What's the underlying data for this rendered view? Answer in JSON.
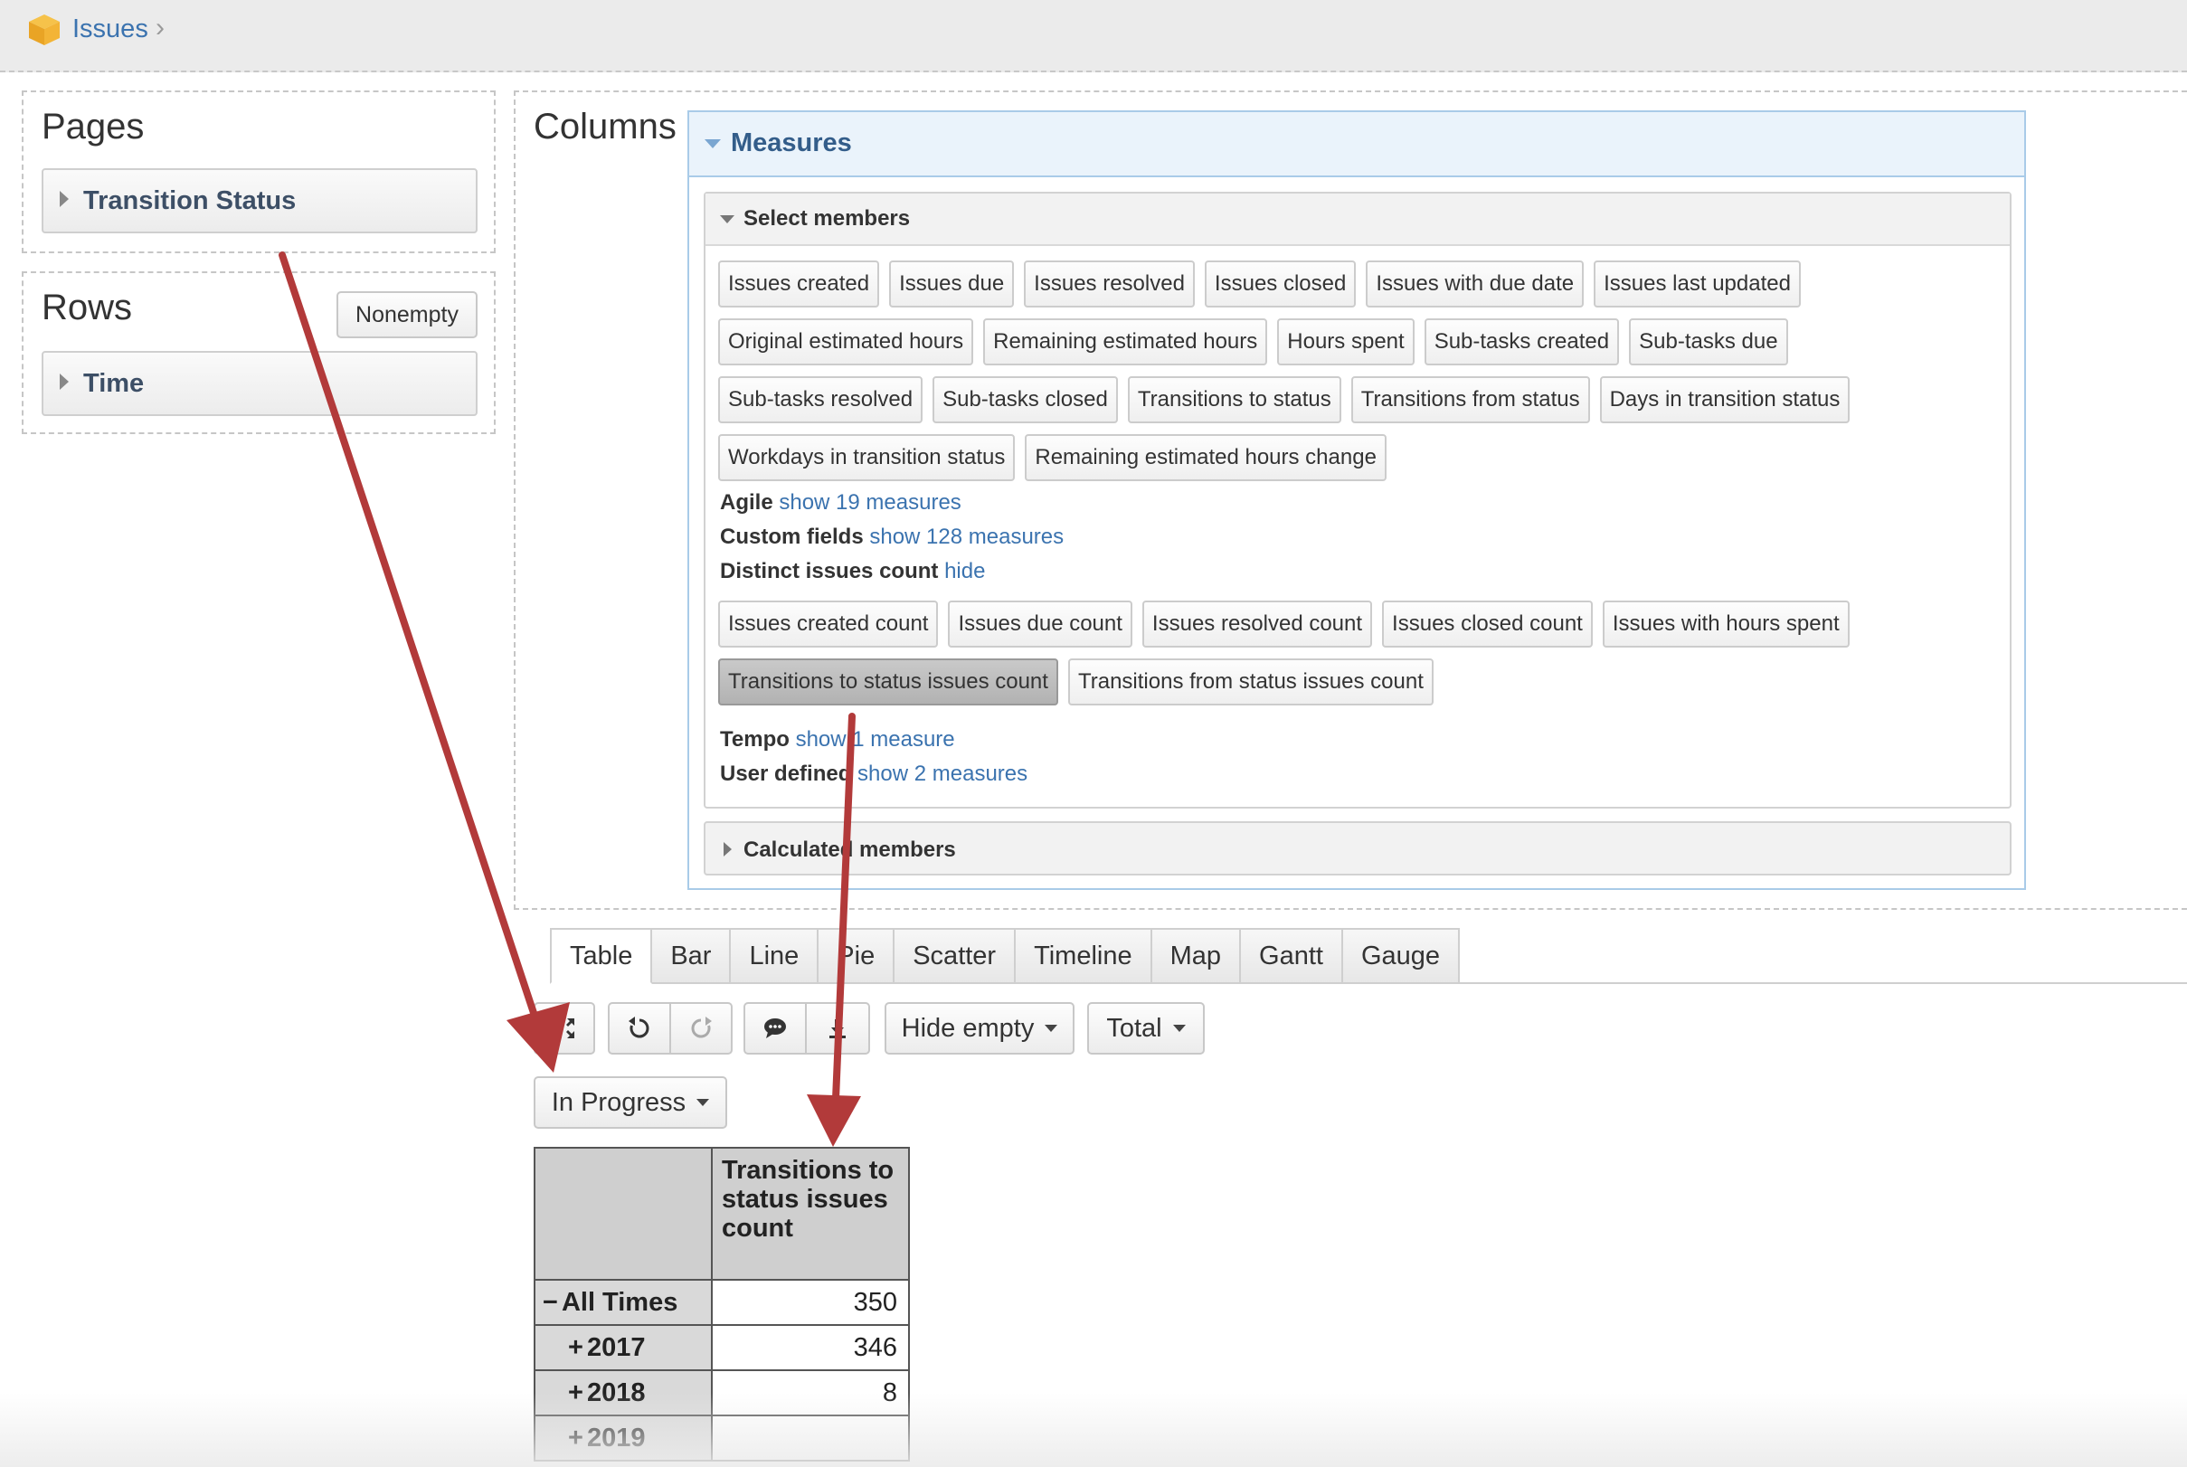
{
  "breadcrumb": {
    "root": "Issues"
  },
  "pages_panel": {
    "title": "Pages",
    "dimension": "Transition Status"
  },
  "rows_panel": {
    "title": "Rows",
    "nonempty_button": "Nonempty",
    "dimension": "Time"
  },
  "columns_panel": {
    "title": "Columns",
    "measures_header": "Measures",
    "select_members_header": "Select members",
    "measures": [
      "Issues created",
      "Issues due",
      "Issues resolved",
      "Issues closed",
      "Issues with due date",
      "Issues last updated",
      "Original estimated hours",
      "Remaining estimated hours",
      "Hours spent",
      "Sub-tasks created",
      "Sub-tasks due",
      "Sub-tasks resolved",
      "Sub-tasks closed",
      "Transitions to status",
      "Transitions from status",
      "Days in transition status",
      "Workdays in transition status",
      "Remaining estimated hours change"
    ],
    "groups": {
      "agile": {
        "name": "Agile",
        "link": "show 19 measures"
      },
      "custom_fields": {
        "name": "Custom fields",
        "link": "show 128 measures"
      },
      "distinct": {
        "name": "Distinct issues count",
        "link": "hide"
      },
      "tempo": {
        "name": "Tempo",
        "link": "show 1 measure"
      },
      "user_defined": {
        "name": "User defined",
        "link": "show 2 measures"
      }
    },
    "distinct_measures": [
      "Issues created count",
      "Issues due count",
      "Issues resolved count",
      "Issues closed count",
      "Issues with hours spent",
      "Transitions to status issues count",
      "Transitions from status issues count"
    ],
    "selected_measure": "Transitions to status issues count",
    "calculated_members_header": "Calculated members"
  },
  "view_tabs": [
    "Table",
    "Bar",
    "Line",
    "Pie",
    "Scatter",
    "Timeline",
    "Map",
    "Gantt",
    "Gauge"
  ],
  "active_tab": "Table",
  "toolbar": {
    "hide_empty": "Hide empty",
    "total": "Total"
  },
  "page_filter": "In Progress",
  "table": {
    "column_header": "Transitions to status issues count",
    "rows": [
      {
        "label": "All Times",
        "toggle": "−",
        "value": "350"
      },
      {
        "label": "2017",
        "toggle": "+",
        "value": "346"
      },
      {
        "label": "2018",
        "toggle": "+",
        "value": "8"
      },
      {
        "label": "2019",
        "toggle": "+",
        "value": ""
      }
    ]
  },
  "colors": {
    "link": "#3b73af",
    "arrow": "#b23a3a",
    "measures_header_bg": "#eaf3fb"
  }
}
